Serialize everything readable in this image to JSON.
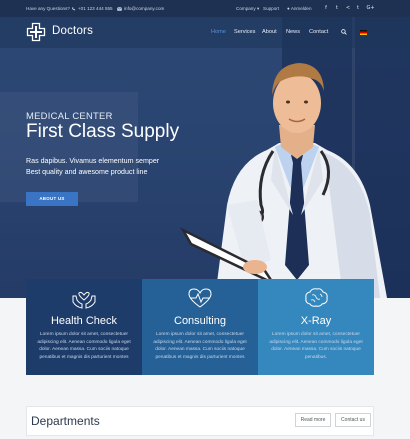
{
  "topbar": {
    "question": "Have any Questions?",
    "phone": "+01 123 444 555",
    "email": "info@company.com",
    "company": "Company",
    "support": "Support",
    "login": "Anmelden",
    "social": [
      {
        "icon": "facebook-icon",
        "glyph": "f"
      },
      {
        "icon": "twitter-icon",
        "glyph": "t"
      },
      {
        "icon": "share-icon",
        "glyph": "<"
      },
      {
        "icon": "tumblr-icon",
        "glyph": "t"
      },
      {
        "icon": "google-plus-icon",
        "glyph": "G+"
      }
    ]
  },
  "brand": {
    "name": "Doctors"
  },
  "nav": {
    "items": [
      "Home",
      "Services",
      "About",
      "News",
      "Contact"
    ],
    "active": "Home"
  },
  "hero": {
    "kicker": "MEDICAL CENTER",
    "title": "First Class Supply",
    "subtitle_1": "Ras dapibus. Vivamus elementum semper",
    "subtitle_2": "Best quality and awesome product line",
    "button": "ABOUT US"
  },
  "cards": [
    {
      "icon": "hands-heart-icon",
      "title": "Health Check",
      "body": "Lorem ipsum dolor sit amet, consectetuer adipiscing elit. Aenean commodo ligula eget dolor. Aenean massa. Cum sociis natoque penatibus et magnis dis parturient montes",
      "color": "#1e3c6a"
    },
    {
      "icon": "heartbeat-icon",
      "title": "Consulting",
      "body": "Lorem ipsum dolor sit amet, consectetuer adipiscing elit. Aenean commodo ligula eget dolor. Aenean massa. Cum sociis natoque penatibus et magnis dis parturient montes",
      "color": "#256196"
    },
    {
      "icon": "brain-icon",
      "title": "X-Ray",
      "body": "Lorem ipsum dolor sit amet, consectetuer adipiscing elit. Aenean commodo ligula eget dolor. Aenean massa. Cum sociis natoque penatibus.",
      "color": "#3588bd"
    }
  ],
  "departments": {
    "title": "Departments",
    "read_more": "Read more",
    "contact": "Contact us"
  }
}
